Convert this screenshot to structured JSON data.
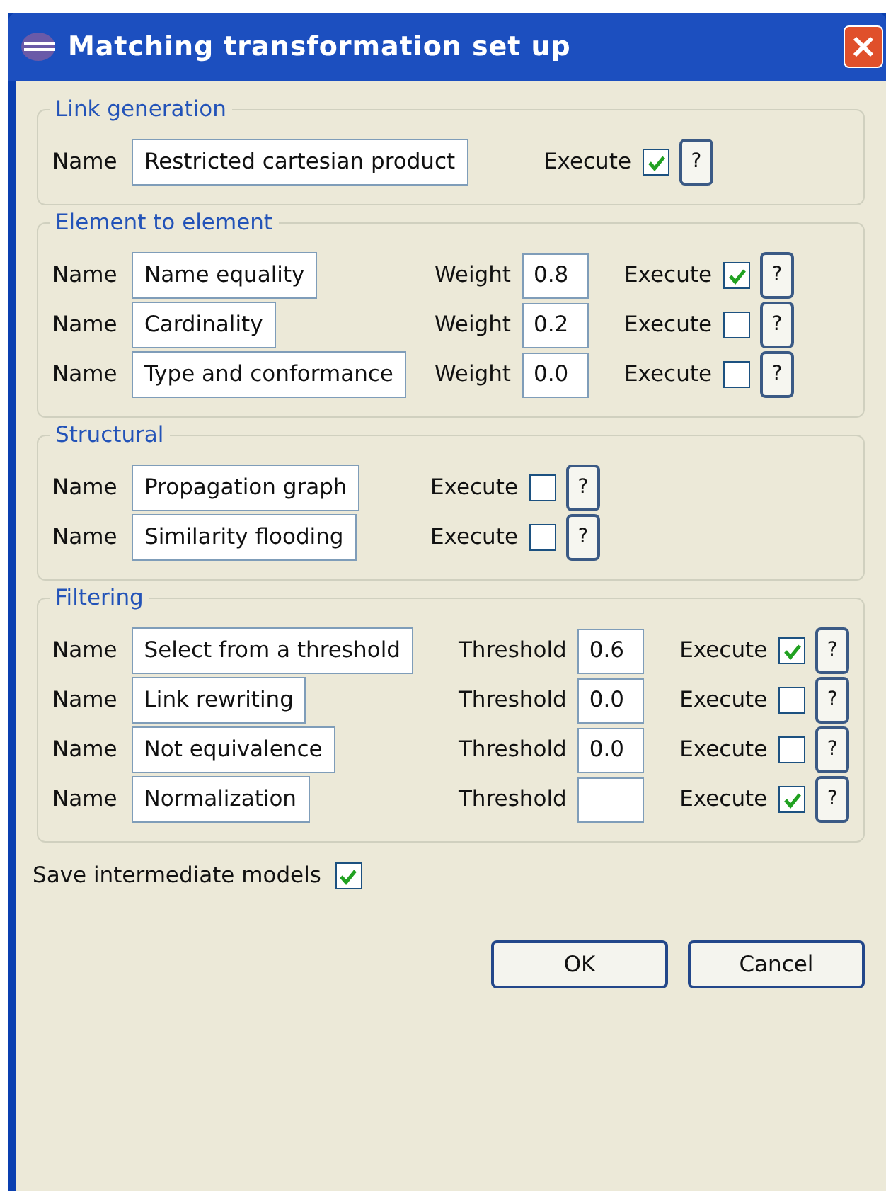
{
  "window": {
    "title": "Matching transformation set up"
  },
  "groups": [
    {
      "title": "Link generation",
      "rows": [
        {
          "name_label": "Name",
          "name": "Restricted cartesian product",
          "execute_label": "Execute",
          "checked": true,
          "help": "?"
        }
      ]
    },
    {
      "title": "Element to element",
      "rows": [
        {
          "name_label": "Name",
          "name": "Name equality",
          "param_label": "Weight",
          "param_value": "0.8",
          "execute_label": "Execute",
          "checked": true,
          "help": "?"
        },
        {
          "name_label": "Name",
          "name": "Cardinality",
          "param_label": "Weight",
          "param_value": "0.2",
          "execute_label": "Execute",
          "checked": false,
          "help": "?"
        },
        {
          "name_label": "Name",
          "name": "Type and conformance",
          "param_label": "Weight",
          "param_value": "0.0",
          "execute_label": "Execute",
          "checked": false,
          "help": "?"
        }
      ]
    },
    {
      "title": "Structural",
      "rows": [
        {
          "name_label": "Name",
          "name": "Propagation graph",
          "execute_label": "Execute",
          "checked": false,
          "help": "?"
        },
        {
          "name_label": "Name",
          "name": "Similarity flooding",
          "execute_label": "Execute",
          "checked": false,
          "help": "?"
        }
      ]
    },
    {
      "title": "Filtering",
      "rows": [
        {
          "name_label": "Name",
          "name": "Select from a threshold",
          "param_label": "Threshold",
          "param_value": "0.6",
          "execute_label": "Execute",
          "checked": true,
          "help": "?"
        },
        {
          "name_label": "Name",
          "name": "Link rewriting",
          "param_label": "Threshold",
          "param_value": "0.0",
          "execute_label": "Execute",
          "checked": false,
          "help": "?"
        },
        {
          "name_label": "Name",
          "name": "Not equivalence",
          "param_label": "Threshold",
          "param_value": "0.0",
          "execute_label": "Execute",
          "checked": false,
          "help": "?"
        },
        {
          "name_label": "Name",
          "name": "Normalization",
          "param_label": "Threshold",
          "execute_label": "Execute",
          "checked": true,
          "help": "?"
        }
      ]
    }
  ],
  "save": {
    "label": "Save intermediate models",
    "checked": true
  },
  "buttons": [
    "OK",
    "Cancel"
  ]
}
